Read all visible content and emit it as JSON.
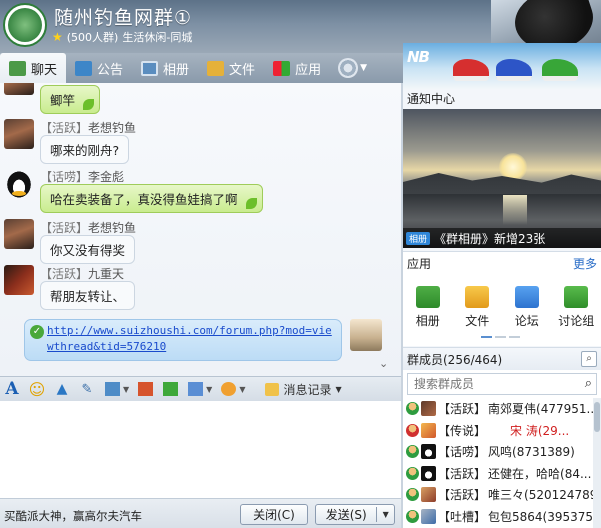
{
  "header": {
    "title": "随州钓鱼网群①",
    "member_count": "(500人群)",
    "category": "生活休闲-同城"
  },
  "tabs": [
    {
      "label": "聊天",
      "icon": "chat-icon",
      "active": true
    },
    {
      "label": "公告",
      "icon": "notice-icon"
    },
    {
      "label": "相册",
      "icon": "album-icon"
    },
    {
      "label": "文件",
      "icon": "file-icon"
    },
    {
      "label": "应用",
      "icon": "app-icon"
    }
  ],
  "banner": {
    "brand": "NB"
  },
  "messages": [
    {
      "sender_role": "",
      "sender_name": "",
      "text": "鲫竿",
      "style": "green"
    },
    {
      "sender_role": "【活跃】",
      "sender_name": "老想钓鱼",
      "text": "哪来的刚舟?",
      "style": "plain"
    },
    {
      "sender_role": "【话唠】",
      "sender_name": "李金彪",
      "text": "哈在卖装备了，真没得鱼娃搞了啊",
      "style": "green"
    },
    {
      "sender_role": "【活跃】",
      "sender_name": "老想钓鱼",
      "text": "你又没有得奖",
      "style": "plain"
    },
    {
      "sender_role": "【活跃】",
      "sender_name": "九重天",
      "text": "帮朋友转让、",
      "style": "plain"
    }
  ],
  "link_message": {
    "url": "http://www.suizhoushi.com/forum.php?mod=viewthread&tid=576210"
  },
  "toolbar": {
    "history_label": "消息记录"
  },
  "bottom": {
    "ad_text": "买酷派大神，赢高尔夫汽车",
    "close_label": "关闭(C)",
    "send_label": "发送(S)"
  },
  "right_panel": {
    "notice_title": "通知中心",
    "notice_tag": "相册",
    "notice_caption": "《群相册》新增23张",
    "app_title": "应用",
    "app_more": "更多",
    "apps": [
      {
        "label": "相册",
        "icon": "album-app-icon"
      },
      {
        "label": "文件",
        "icon": "file-app-icon"
      },
      {
        "label": "论坛",
        "icon": "forum-app-icon"
      },
      {
        "label": "讨论组",
        "icon": "discussion-app-icon"
      }
    ],
    "members_title": "群成员(256/464)",
    "search_placeholder": "搜索群成员",
    "members": [
      {
        "role": "【活跃】",
        "name": "南郊夏伟(477951...",
        "highlight": false
      },
      {
        "role": "【传说】",
        "name": "宋 涛(29...",
        "highlight": true
      },
      {
        "role": "【话唠】",
        "name": "风鸣(8731389)",
        "highlight": false
      },
      {
        "role": "【活跃】",
        "name": "还健在，哈哈(84...",
        "highlight": false
      },
      {
        "role": "【活跃】",
        "name": "唯三々(520124789)",
        "highlight": false
      },
      {
        "role": "【吐槽】",
        "name": "包包5864(395375...",
        "highlight": false
      }
    ]
  },
  "colors": {
    "accent_green": "#6cbf2a",
    "link_blue": "#1a4bcc",
    "highlight_red": "#d01f1f"
  }
}
